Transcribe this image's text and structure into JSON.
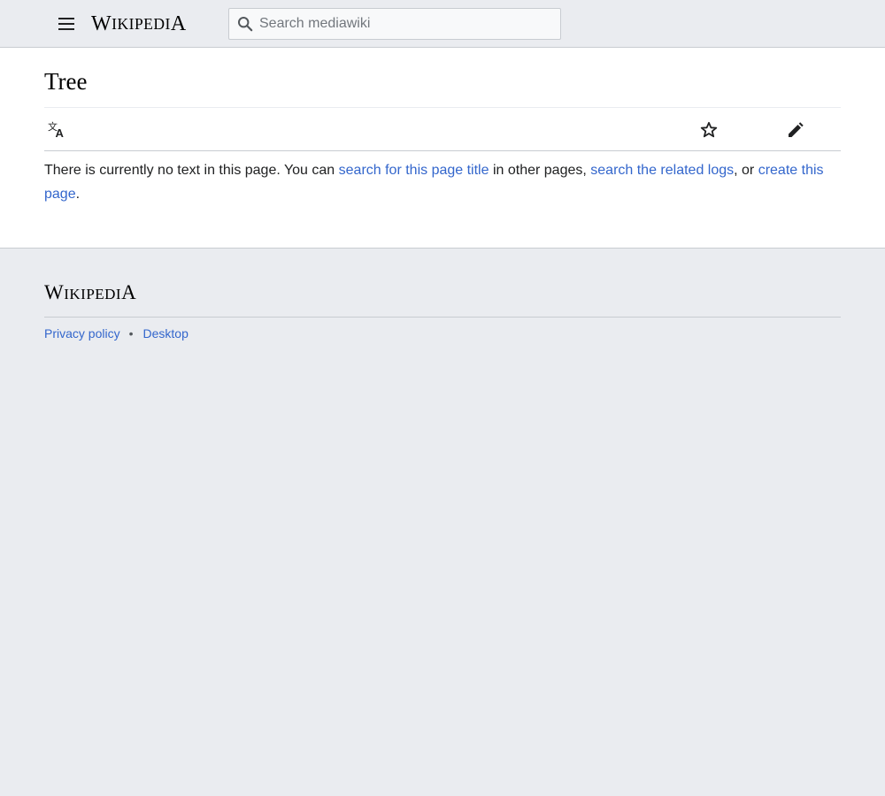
{
  "header": {
    "wordmark": {
      "first": "W",
      "rest": "ikipedi",
      "last": "A"
    },
    "search": {
      "placeholder": "Search mediawiki",
      "value": ""
    }
  },
  "page": {
    "title": "Tree",
    "message": {
      "intro": "There is currently no text in this page. You can ",
      "link_search_title": "search for this page title",
      "mid1": " in other pages, ",
      "link_related_logs": "search the related logs",
      "mid2": ", or ",
      "link_create": "create this page",
      "end": "."
    }
  },
  "toolbar": {
    "icons": [
      "language-icon",
      "star-icon",
      "pencil-icon"
    ]
  },
  "footer": {
    "wordmark": {
      "first": "W",
      "rest": "ikipedi",
      "last": "A"
    },
    "links": {
      "privacy": "Privacy policy",
      "separator": "•",
      "desktop": "Desktop"
    }
  },
  "colors": {
    "link": "#3366cc",
    "chrome_bg": "#eaecf0",
    "content_bg": "#ffffff",
    "border": "#c8ccd1",
    "text": "#202122"
  }
}
